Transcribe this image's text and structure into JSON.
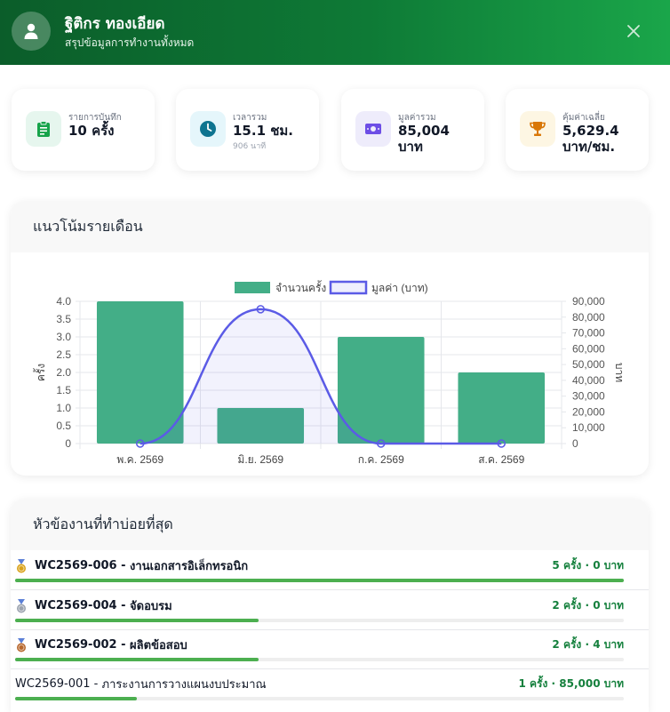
{
  "header": {
    "name": "ฐิติกร ทองเอียด",
    "subtitle": "สรุปข้อมูลการทำงานทั้งหมด"
  },
  "stats": [
    {
      "label": "รายการบันทึก",
      "value": "10 ครั้ง",
      "sub": "",
      "icon": "clipboard-icon",
      "bg": "#e6f6ee",
      "fg": "#16a34a"
    },
    {
      "label": "เวลารวม",
      "value": "15.1 ชม.",
      "sub": "906 นาที",
      "icon": "clock-icon",
      "bg": "#e5f6fb",
      "fg": "#0e7490"
    },
    {
      "label": "มูลค่ารวม",
      "value_line1": "85,004",
      "value_line2": "บาท",
      "icon": "money-icon",
      "bg": "#eeecfb",
      "fg": "#6d4ee6"
    },
    {
      "label": "คุ้มค่าเฉลี่ย",
      "value_line1": "5,629.4",
      "value_line2": "บาท/ชม.",
      "icon": "trophy-icon",
      "bg": "#fdf6e3",
      "fg": "#d97706"
    }
  ],
  "trend": {
    "title": "แนวโน้มรายเดือน"
  },
  "chart_data": {
    "type": "bar",
    "categories": [
      "พ.ค. 2569",
      "มิ.ย. 2569",
      "ก.ค. 2569",
      "ส.ค. 2569"
    ],
    "series": [
      {
        "name": "จำนวนครั้ง",
        "type": "bar",
        "values": [
          4,
          1,
          3,
          2
        ],
        "color": "#43ae87",
        "axis": "left"
      },
      {
        "name": "มูลค่า (บาท)",
        "type": "line",
        "values": [
          0,
          85000,
          0,
          0
        ],
        "color": "#5b5be6",
        "axis": "right"
      }
    ],
    "ylabel": "ครั้ง",
    "y2label": "บาท",
    "ylim": [
      0,
      4
    ],
    "y2lim": [
      0,
      90000
    ],
    "yticks": [
      "0",
      "0.5",
      "1.0",
      "1.5",
      "2.0",
      "2.5",
      "3.0",
      "3.5",
      "4.0"
    ],
    "y2ticks": [
      "0",
      "10,000",
      "20,000",
      "30,000",
      "40,000",
      "50,000",
      "60,000",
      "70,000",
      "80,000",
      "90,000"
    ],
    "legend": "top-center",
    "grid": true
  },
  "topics": {
    "title": "หัวข้องานที่ทำบ่อยที่สุด",
    "items": [
      {
        "code": "WC2569-006",
        "name": "งานเอกสารอิเล็กทรอนิก",
        "meta": "5 ครั้ง · 0 บาท",
        "pct": 1.0,
        "medal": "gold",
        "bold": true
      },
      {
        "code": "WC2569-004",
        "name": "จัดอบรม",
        "meta": "2 ครั้ง · 0 บาท",
        "pct": 0.4,
        "medal": "silver",
        "bold": true
      },
      {
        "code": "WC2569-002",
        "name": "ผลิตข้อสอบ",
        "meta": "2 ครั้ง · 4 บาท",
        "pct": 0.4,
        "medal": "bronze",
        "bold": true
      },
      {
        "code": "WC2569-001",
        "name": "ภาระงานการวางแผนงบประมาณ",
        "meta": "1 ครั้ง · 85,000 บาท",
        "pct": 0.2,
        "medal": "",
        "bold": false
      }
    ]
  }
}
